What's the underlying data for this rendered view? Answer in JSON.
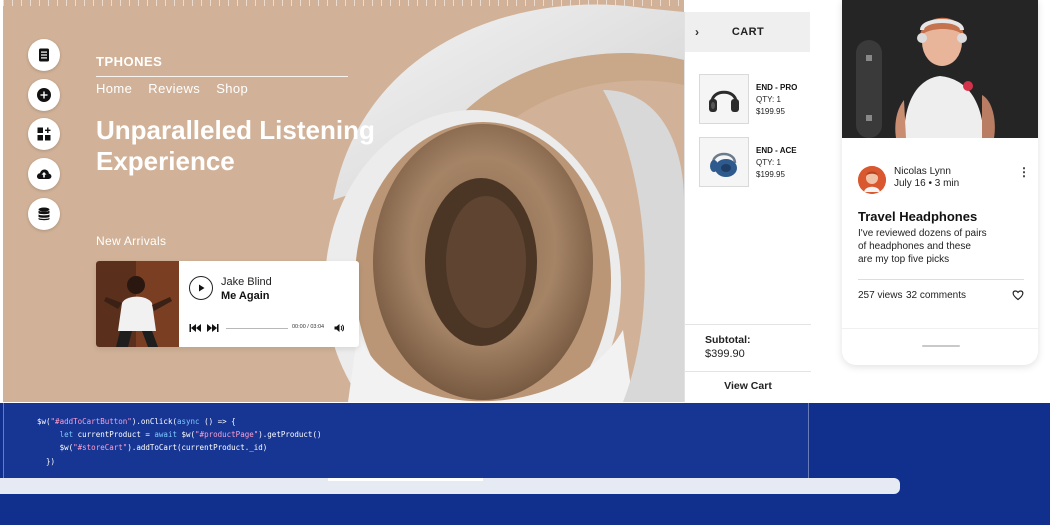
{
  "hero": {
    "brand": "TPHONES",
    "nav": [
      "Home",
      "Reviews",
      "Shop"
    ],
    "headline": "Unparalleled Listening Experience",
    "section_label": "New Arrivals",
    "colors": {
      "background": "#d1b298",
      "text": "#ffffff"
    }
  },
  "side_toolbar": {
    "icons": [
      "page-icon",
      "add-icon",
      "apps-icon",
      "cloud-upload-icon",
      "database-icon"
    ]
  },
  "player": {
    "artist": "Jake Blind",
    "song": "Me Again",
    "time": "00:00 / 03:04"
  },
  "cart": {
    "back_glyph": "›",
    "title": "CART",
    "items": [
      {
        "name": "END - PRO",
        "qty": "QTY: 1",
        "price": "$199.95",
        "color": "#2b2b2b"
      },
      {
        "name": "END - ACE",
        "qty": "QTY: 1",
        "price": "$199.95",
        "color": "#2f5a8e"
      }
    ],
    "subtotal_label": "Subtotal:",
    "subtotal_value": "$399.90",
    "view_cart_label": "View Cart"
  },
  "blog": {
    "author": "Nicolas Lynn",
    "date": "July 16 •  3 min",
    "more_glyph": "⋮",
    "title": "Travel Headphones",
    "excerpt": "I've reviewed dozens of pairs of headphones and these are my top five picks",
    "views": "257 views",
    "comments": "32 comments"
  },
  "code": {
    "lines": [
      [
        "$w(",
        "\"#addToCartButton\"",
        ").onClick(",
        "async",
        " () => {"
      ],
      [
        "     ",
        "let",
        " currentProduct = ",
        "await",
        " $w(",
        "\"#productPage\"",
        ").getProduct()"
      ],
      [
        "     $w(",
        "\"#storeCart\"",
        ").addToCart(currentProduct._id)"
      ],
      [
        "  })"
      ]
    ],
    "colors": {
      "background": "#173693",
      "string": "#ff9fd0",
      "keyword": "#7fc8ff"
    }
  }
}
